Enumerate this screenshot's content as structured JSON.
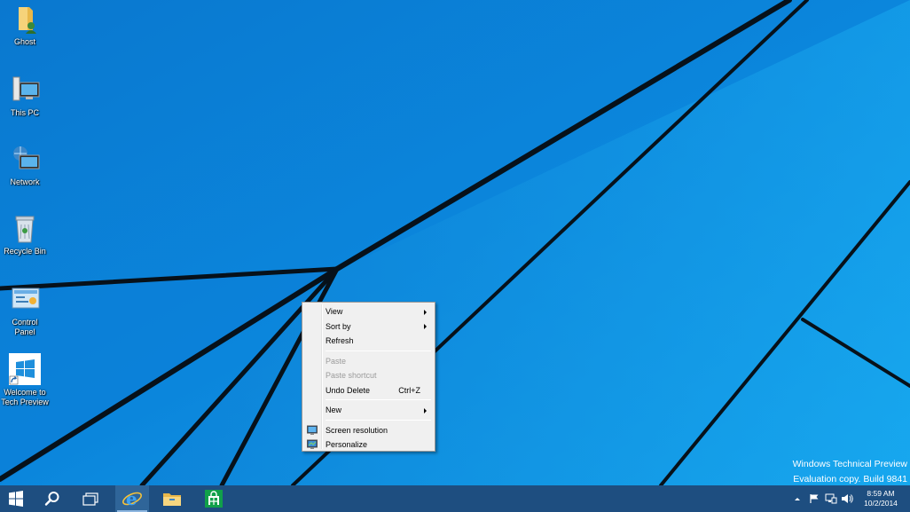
{
  "desktop": {
    "icons": [
      {
        "label": "Ghost",
        "icon": "user-folder-icon"
      },
      {
        "label": "This PC",
        "icon": "computer-icon"
      },
      {
        "label": "Network",
        "icon": "network-icon"
      },
      {
        "label": "Recycle Bin",
        "icon": "recycle-bin-icon"
      },
      {
        "label": "Control\nPanel",
        "icon": "control-panel-icon"
      },
      {
        "label": "Welcome to\nTech Preview",
        "icon": "windows-shortcut-icon"
      }
    ],
    "accent_color": "#0a7fd6"
  },
  "context_menu": {
    "view": "View",
    "sort_by": "Sort by",
    "refresh": "Refresh",
    "paste": "Paste",
    "paste_shortcut": "Paste shortcut",
    "undo_delete": "Undo Delete",
    "undo_delete_shortcut": "Ctrl+Z",
    "new": "New",
    "screen_resolution": "Screen resolution",
    "personalize": "Personalize"
  },
  "watermark": {
    "line1": "Windows Technical Preview",
    "line2": "Evaluation copy. Build 9841"
  },
  "taskbar": {
    "color": "#1e4e80",
    "pinned": [
      "start-icon",
      "search-icon",
      "task-view-icon",
      "internet-explorer-icon",
      "file-explorer-icon",
      "store-icon"
    ],
    "clock_time": "8:59 AM",
    "clock_date": "10/2/2014"
  }
}
